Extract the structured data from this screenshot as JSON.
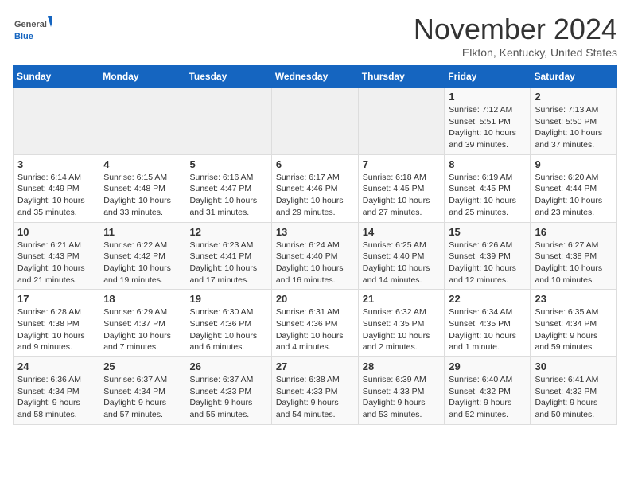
{
  "header": {
    "logo_general": "General",
    "logo_blue": "Blue",
    "month_title": "November 2024",
    "location": "Elkton, Kentucky, United States"
  },
  "weekdays": [
    "Sunday",
    "Monday",
    "Tuesday",
    "Wednesday",
    "Thursday",
    "Friday",
    "Saturday"
  ],
  "weeks": [
    [
      {
        "day": "",
        "info": ""
      },
      {
        "day": "",
        "info": ""
      },
      {
        "day": "",
        "info": ""
      },
      {
        "day": "",
        "info": ""
      },
      {
        "day": "",
        "info": ""
      },
      {
        "day": "1",
        "info": "Sunrise: 7:12 AM\nSunset: 5:51 PM\nDaylight: 10 hours\nand 39 minutes."
      },
      {
        "day": "2",
        "info": "Sunrise: 7:13 AM\nSunset: 5:50 PM\nDaylight: 10 hours\nand 37 minutes."
      }
    ],
    [
      {
        "day": "3",
        "info": "Sunrise: 6:14 AM\nSunset: 4:49 PM\nDaylight: 10 hours\nand 35 minutes."
      },
      {
        "day": "4",
        "info": "Sunrise: 6:15 AM\nSunset: 4:48 PM\nDaylight: 10 hours\nand 33 minutes."
      },
      {
        "day": "5",
        "info": "Sunrise: 6:16 AM\nSunset: 4:47 PM\nDaylight: 10 hours\nand 31 minutes."
      },
      {
        "day": "6",
        "info": "Sunrise: 6:17 AM\nSunset: 4:46 PM\nDaylight: 10 hours\nand 29 minutes."
      },
      {
        "day": "7",
        "info": "Sunrise: 6:18 AM\nSunset: 4:45 PM\nDaylight: 10 hours\nand 27 minutes."
      },
      {
        "day": "8",
        "info": "Sunrise: 6:19 AM\nSunset: 4:45 PM\nDaylight: 10 hours\nand 25 minutes."
      },
      {
        "day": "9",
        "info": "Sunrise: 6:20 AM\nSunset: 4:44 PM\nDaylight: 10 hours\nand 23 minutes."
      }
    ],
    [
      {
        "day": "10",
        "info": "Sunrise: 6:21 AM\nSunset: 4:43 PM\nDaylight: 10 hours\nand 21 minutes."
      },
      {
        "day": "11",
        "info": "Sunrise: 6:22 AM\nSunset: 4:42 PM\nDaylight: 10 hours\nand 19 minutes."
      },
      {
        "day": "12",
        "info": "Sunrise: 6:23 AM\nSunset: 4:41 PM\nDaylight: 10 hours\nand 17 minutes."
      },
      {
        "day": "13",
        "info": "Sunrise: 6:24 AM\nSunset: 4:40 PM\nDaylight: 10 hours\nand 16 minutes."
      },
      {
        "day": "14",
        "info": "Sunrise: 6:25 AM\nSunset: 4:40 PM\nDaylight: 10 hours\nand 14 minutes."
      },
      {
        "day": "15",
        "info": "Sunrise: 6:26 AM\nSunset: 4:39 PM\nDaylight: 10 hours\nand 12 minutes."
      },
      {
        "day": "16",
        "info": "Sunrise: 6:27 AM\nSunset: 4:38 PM\nDaylight: 10 hours\nand 10 minutes."
      }
    ],
    [
      {
        "day": "17",
        "info": "Sunrise: 6:28 AM\nSunset: 4:38 PM\nDaylight: 10 hours\nand 9 minutes."
      },
      {
        "day": "18",
        "info": "Sunrise: 6:29 AM\nSunset: 4:37 PM\nDaylight: 10 hours\nand 7 minutes."
      },
      {
        "day": "19",
        "info": "Sunrise: 6:30 AM\nSunset: 4:36 PM\nDaylight: 10 hours\nand 6 minutes."
      },
      {
        "day": "20",
        "info": "Sunrise: 6:31 AM\nSunset: 4:36 PM\nDaylight: 10 hours\nand 4 minutes."
      },
      {
        "day": "21",
        "info": "Sunrise: 6:32 AM\nSunset: 4:35 PM\nDaylight: 10 hours\nand 2 minutes."
      },
      {
        "day": "22",
        "info": "Sunrise: 6:34 AM\nSunset: 4:35 PM\nDaylight: 10 hours\nand 1 minute."
      },
      {
        "day": "23",
        "info": "Sunrise: 6:35 AM\nSunset: 4:34 PM\nDaylight: 9 hours\nand 59 minutes."
      }
    ],
    [
      {
        "day": "24",
        "info": "Sunrise: 6:36 AM\nSunset: 4:34 PM\nDaylight: 9 hours\nand 58 minutes."
      },
      {
        "day": "25",
        "info": "Sunrise: 6:37 AM\nSunset: 4:34 PM\nDaylight: 9 hours\nand 57 minutes."
      },
      {
        "day": "26",
        "info": "Sunrise: 6:37 AM\nSunset: 4:33 PM\nDaylight: 9 hours\nand 55 minutes."
      },
      {
        "day": "27",
        "info": "Sunrise: 6:38 AM\nSunset: 4:33 PM\nDaylight: 9 hours\nand 54 minutes."
      },
      {
        "day": "28",
        "info": "Sunrise: 6:39 AM\nSunset: 4:33 PM\nDaylight: 9 hours\nand 53 minutes."
      },
      {
        "day": "29",
        "info": "Sunrise: 6:40 AM\nSunset: 4:32 PM\nDaylight: 9 hours\nand 52 minutes."
      },
      {
        "day": "30",
        "info": "Sunrise: 6:41 AM\nSunset: 4:32 PM\nDaylight: 9 hours\nand 50 minutes."
      }
    ]
  ]
}
